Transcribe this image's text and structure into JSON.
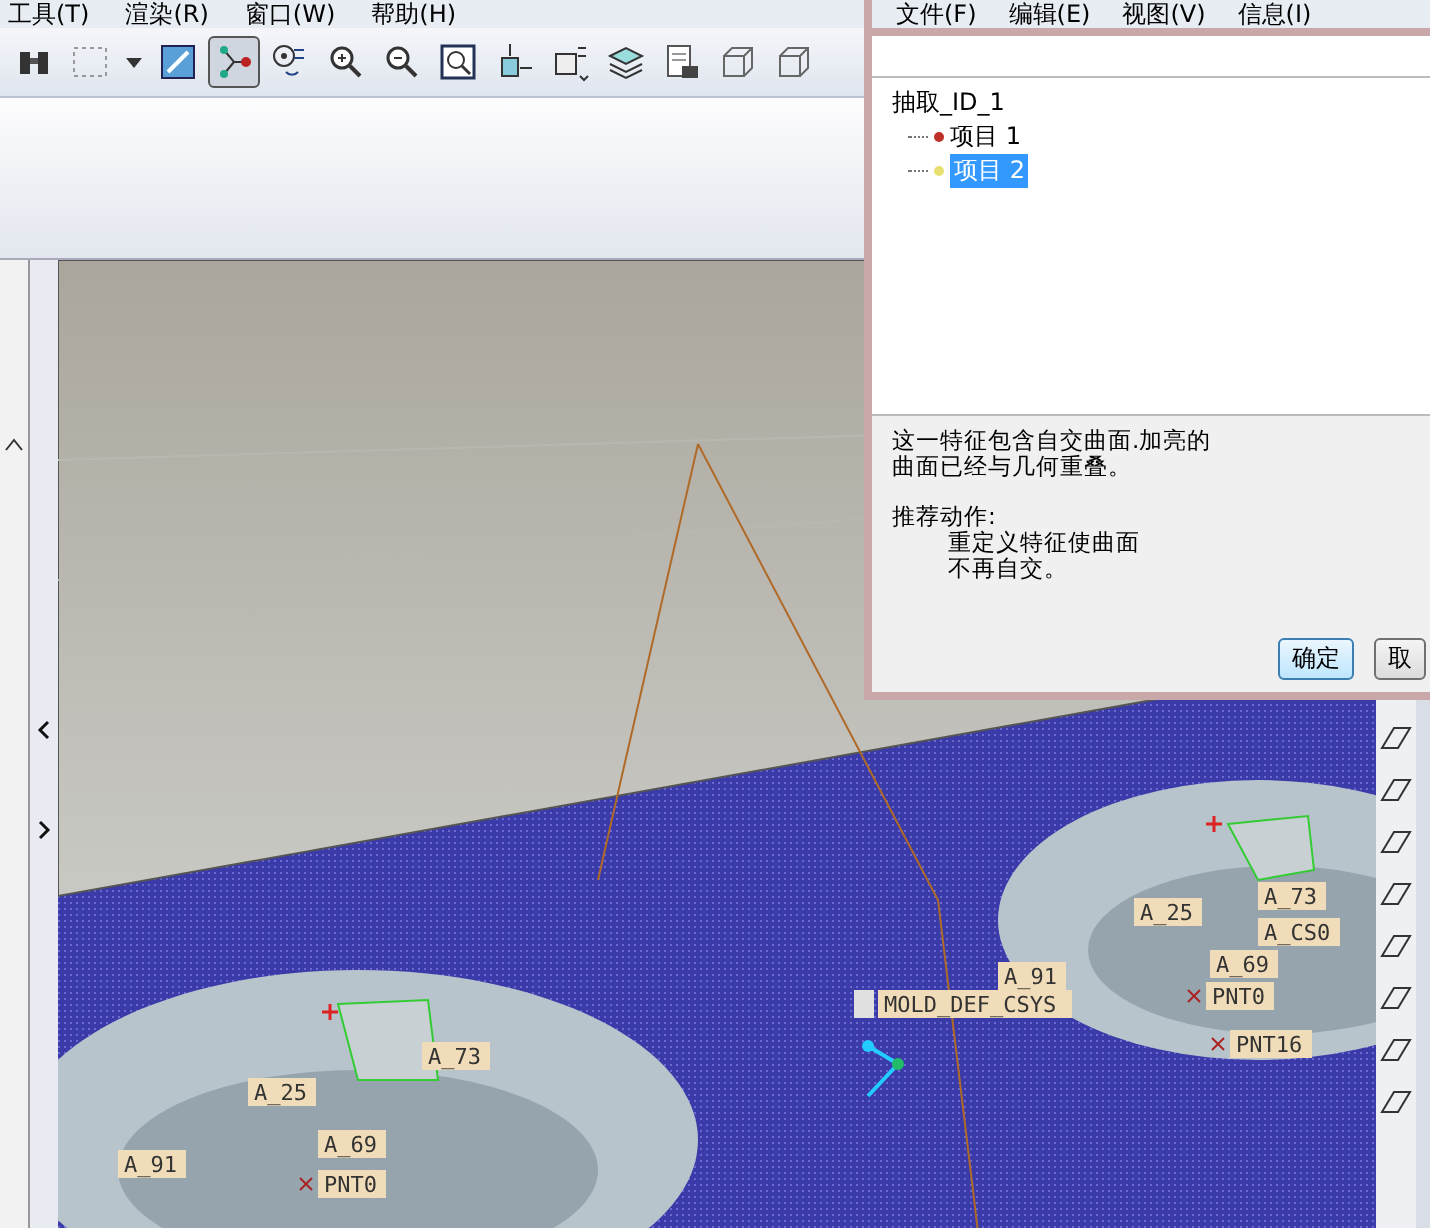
{
  "main_window": {
    "menu": [
      "工具(T)",
      "渲染(R)",
      "窗口(W)",
      "帮助(H)"
    ],
    "toolbar": [
      {
        "kind": "binoculars",
        "selected": false
      },
      {
        "kind": "select-box",
        "selected": false
      },
      {
        "kind": "caret",
        "selected": false
      },
      {
        "kind": "shade",
        "selected": false
      },
      {
        "kind": "nodes",
        "selected": true
      },
      {
        "kind": "spin",
        "selected": false
      },
      {
        "kind": "zoom-in",
        "selected": false
      },
      {
        "kind": "zoom-out",
        "selected": false
      },
      {
        "kind": "refit",
        "selected": false
      },
      {
        "kind": "orient",
        "selected": false
      },
      {
        "kind": "view",
        "selected": false
      },
      {
        "kind": "layers",
        "selected": false
      },
      {
        "kind": "sheet",
        "selected": false
      },
      {
        "kind": "cube",
        "selected": false
      },
      {
        "kind": "cube",
        "selected": false
      }
    ],
    "viewport": {
      "labels": [
        {
          "text": "A_73",
          "kind": "dimension"
        },
        {
          "text": "A_CS0",
          "kind": "dimension"
        },
        {
          "text": "A_25",
          "kind": "dimension"
        },
        {
          "text": "A_69",
          "kind": "dimension"
        },
        {
          "text": "PNT0",
          "kind": "point"
        },
        {
          "text": "A_91",
          "kind": "dimension"
        },
        {
          "text": "MOLD_DEF_CSYS",
          "kind": "csys"
        },
        {
          "text": "A_25",
          "kind": "dimension"
        },
        {
          "text": "A_73",
          "kind": "dimension"
        },
        {
          "text": "A_69",
          "kind": "dimension"
        },
        {
          "text": "PNT0",
          "kind": "point"
        },
        {
          "text": "A_91",
          "kind": "dimension"
        },
        {
          "text": "PNT16",
          "kind": "point"
        }
      ]
    }
  },
  "dialog": {
    "menu": [
      "文件(F)",
      "编辑(E)",
      "视图(V)",
      "信息(I)"
    ],
    "tree": {
      "label": "抽取_ID_1",
      "children": [
        {
          "label": "项目 1",
          "color": "#c0302a",
          "selected": false
        },
        {
          "label": "项目 2",
          "color": "#e8e070",
          "selected": true
        }
      ]
    },
    "message": [
      "这一特征包含自交曲面.加亮的",
      "曲面已经与几何重叠。"
    ],
    "action_title": "推荐动作:",
    "action": [
      "重定义特征使曲面",
      "不再自交。"
    ],
    "buttons": [
      {
        "label": "确定",
        "kind": "default"
      },
      {
        "label": "取",
        "kind": "normal"
      }
    ]
  }
}
